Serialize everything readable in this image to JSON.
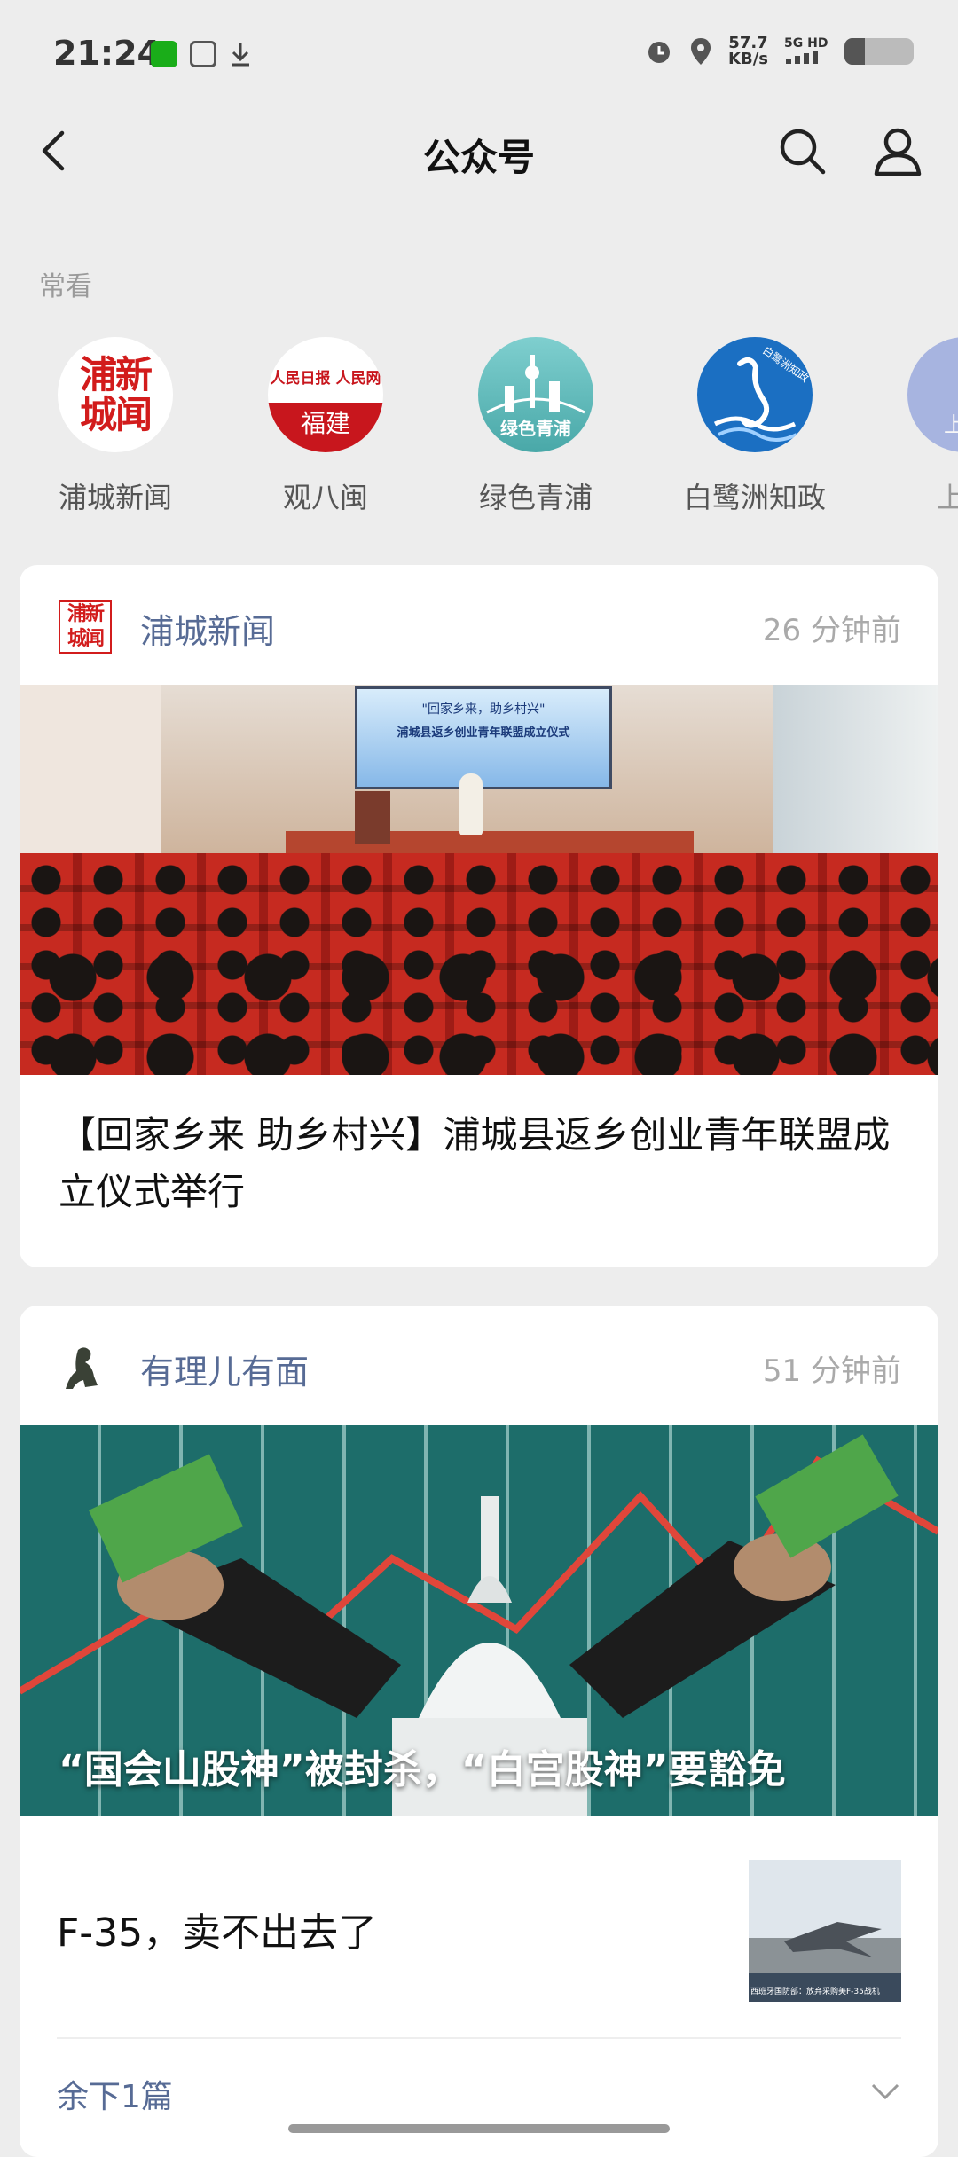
{
  "status": {
    "time": "21:24",
    "net_speed": "57.7",
    "net_unit": "KB/s",
    "signal": "5G HD"
  },
  "nav": {
    "title": "公众号"
  },
  "frequent": {
    "label": "常看",
    "items": [
      {
        "name": "浦城新闻",
        "logo_text_1": "浦新",
        "logo_text_2": "城闻"
      },
      {
        "name": "观八闽",
        "logo_text_top": "人民日报 人民网",
        "logo_text_bottom": "福建"
      },
      {
        "name": "绿色青浦",
        "logo_text": "绿色青浦"
      },
      {
        "name": "白鹭洲知政",
        "logo_text": "白鹭洲知政"
      },
      {
        "name": "上海",
        "logo_text": "上海"
      }
    ]
  },
  "cards": [
    {
      "account": "浦城新闻",
      "time": "26 分钟前",
      "logo_text": "浦新城闻",
      "banner_text_1": "\"回家乡来，助乡村兴\"",
      "banner_text_2": "浦城县返乡创业青年联盟成立仪式",
      "title": "【回家乡来 助乡村兴】浦城县返乡创业青年联盟成立仪式举行"
    },
    {
      "account": "有理儿有面",
      "time": "51 分钟前",
      "cover_title": "“国会山股神”被封杀，“白宫股神”要豁免",
      "sub_title": "F-35，卖不出去了",
      "thumb_caption": "西班牙国防部：放弃采购美F-35战机",
      "rest": "余下1篇"
    }
  ],
  "colors": {
    "link": "#576b95",
    "bg": "#ededed",
    "accent_red": "#d21c1c"
  }
}
